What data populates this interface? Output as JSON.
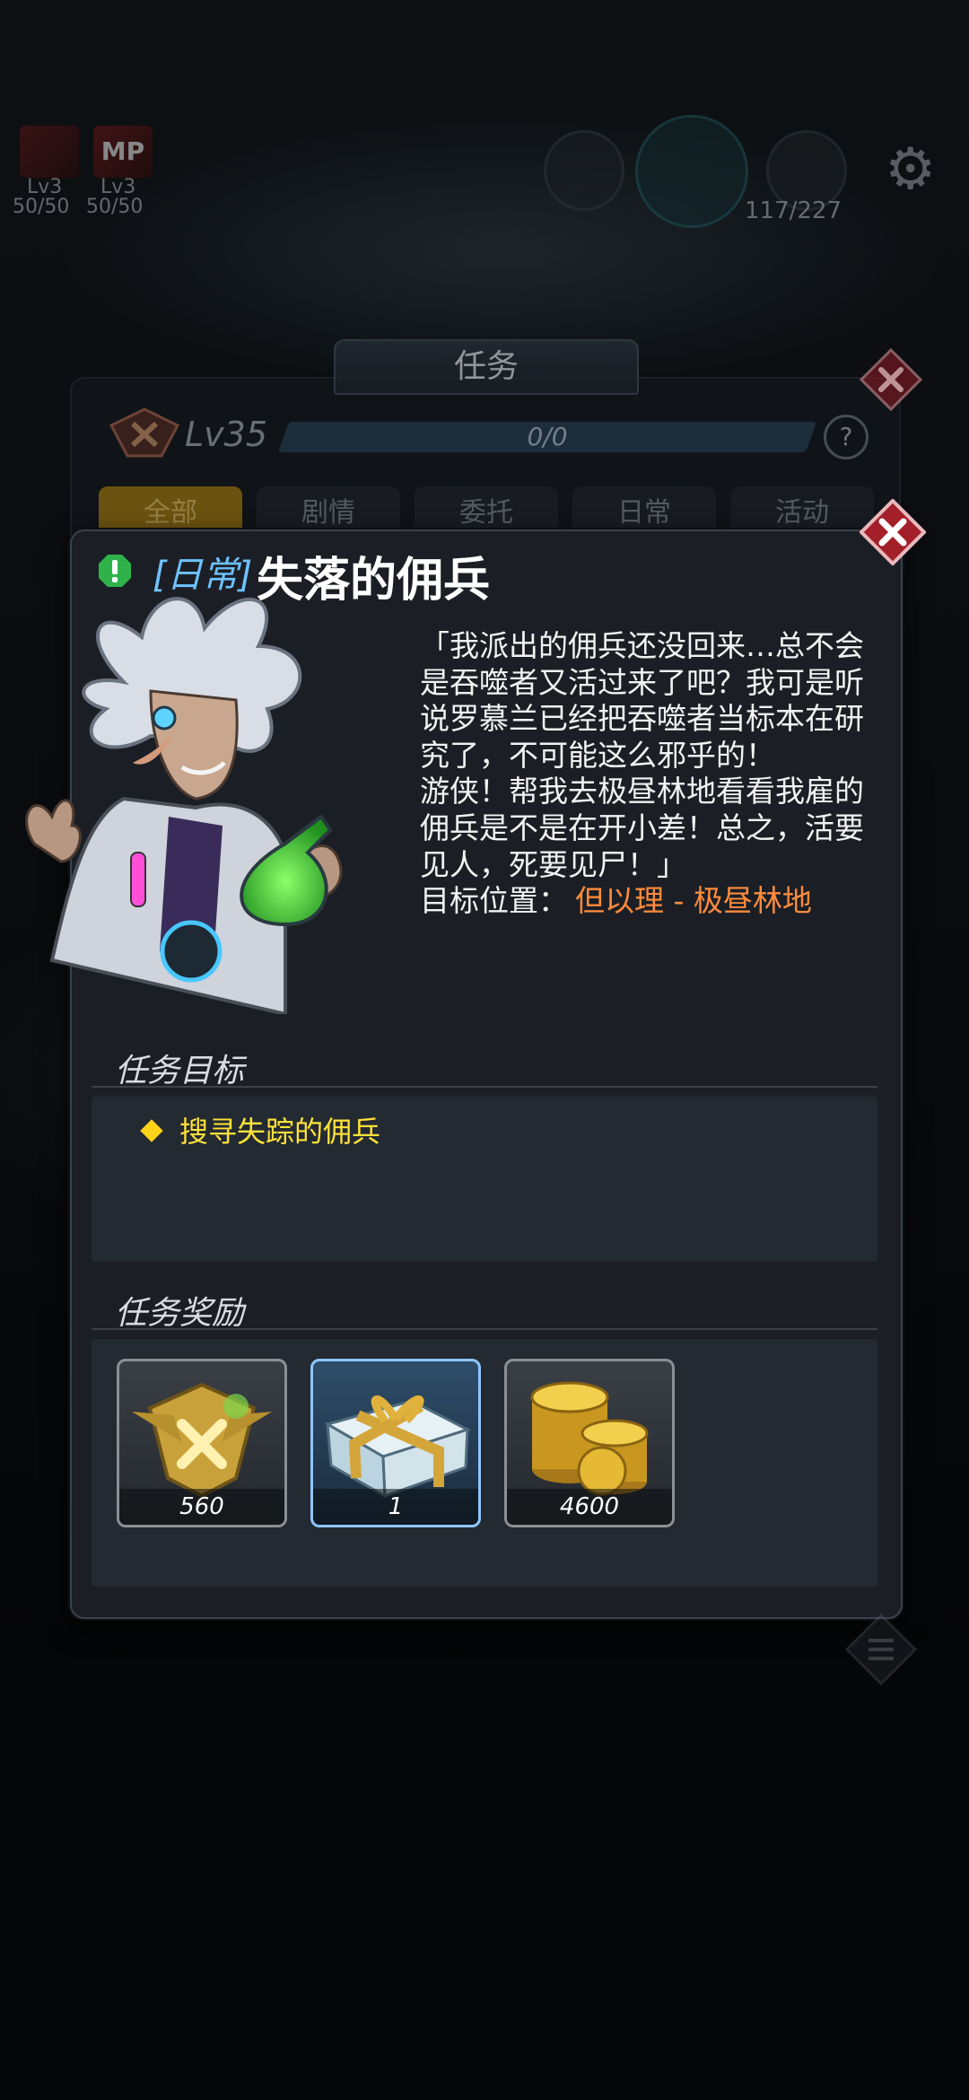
{
  "hud": {
    "skill_a_level": "Lv3",
    "skill_b_label": "MP",
    "skill_b_level": "Lv3",
    "skill_a_value": "50/50",
    "skill_b_value": "50/50",
    "stamina": "117/227"
  },
  "task_panel": {
    "title": "任务",
    "level": "Lv35",
    "progress_text": "0/0",
    "help": "?",
    "tabs": [
      {
        "label": "全部",
        "active": true
      },
      {
        "label": "剧情",
        "active": false
      },
      {
        "label": "委托",
        "active": false
      },
      {
        "label": "日常",
        "active": false
      },
      {
        "label": "活动",
        "active": false
      }
    ]
  },
  "quest": {
    "tag": "[日常]",
    "title": "失落的佣兵",
    "dialog": "「我派出的佣兵还没回来…总不会\n是吞噬者又活过来了吧？我可是听\n说罗慕兰已经把吞噬者当标本在研\n究了，不可能这么邪乎的！\n游侠！帮我去极昼林地看看我雇的\n佣兵是不是在开小差！总之，活要\n见人，死要见尸！」",
    "location_label": "目标位置：",
    "location_value": "但以理 - 极昼林地",
    "objective_title": "任务目标",
    "objectives": [
      "搜寻失踪的佣兵"
    ],
    "reward_title": "任务奖励",
    "rewards": [
      {
        "icon": "medal-icon",
        "count": "560"
      },
      {
        "icon": "gift-box-icon",
        "count": "1"
      },
      {
        "icon": "gold-coins-icon",
        "count": "4600"
      }
    ]
  },
  "colors": {
    "tag_blue": "#6ec2ff",
    "location_orange": "#ff8b3d",
    "objective_yellow": "#ffe23a",
    "close_red": "#a3202a"
  }
}
